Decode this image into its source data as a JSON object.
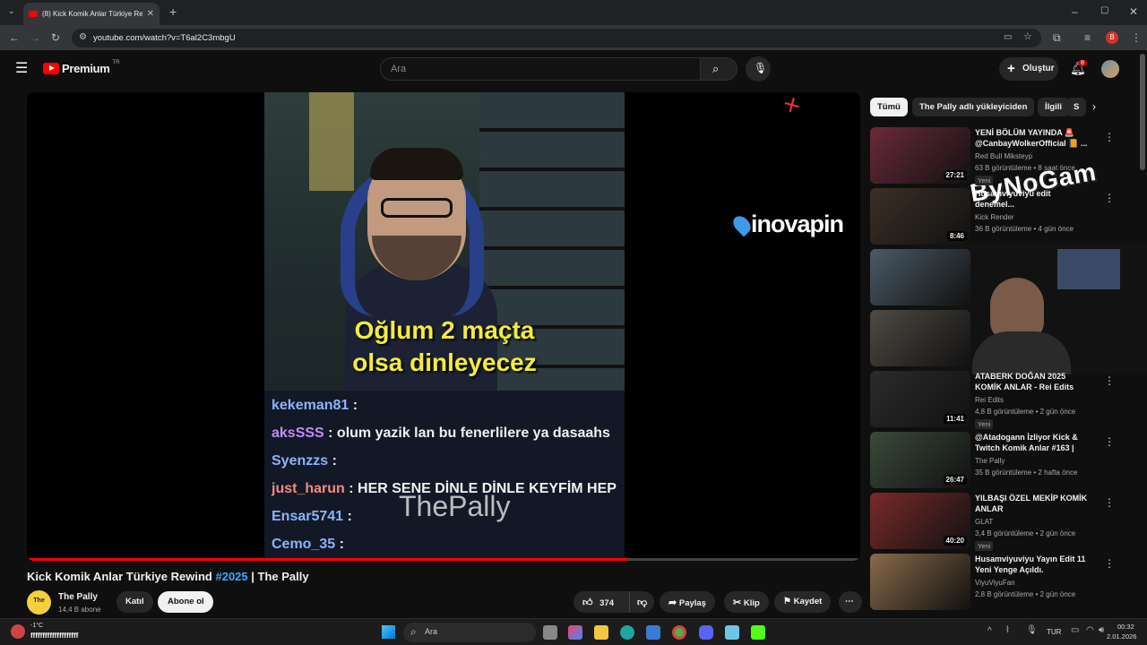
{
  "browser": {
    "tab_title": "(8) Kick Komik Anlar Türkiye Re...",
    "url": "youtube.com/watch?v=T6al2C3mbgU",
    "profile_letter": "B"
  },
  "youtube": {
    "logo_text": "Premium",
    "logo_badge": "TR",
    "search_placeholder": "Ara",
    "create_label": "Oluştur",
    "notif_count": "8"
  },
  "video": {
    "caption_line1": "Oğlum 2 maçta",
    "caption_line2": "olsa dinleyecez",
    "watermark": "ThePally",
    "overlay_brand": "inovapin",
    "overlay_logo": "ByNoGam",
    "chat": [
      {
        "user": "kekeman81",
        "msg": ":",
        "color": "#8ab4f8"
      },
      {
        "user": "aksSSS",
        "msg": ": olum yazik lan bu fenerlilere ya dasaahs",
        "color": "#c58af9"
      },
      {
        "user": "Syenzzs",
        "msg": ":",
        "color": "#8ab4f8"
      },
      {
        "user": "just_harun",
        "msg": ": HER SENE DİNLE DİNLE KEYFİM HEP",
        "color": "#f28b82"
      },
      {
        "user": "Ensar5741",
        "msg": ":",
        "color": "#8ab4f8"
      },
      {
        "user": "Cemo_35",
        "msg": ":",
        "color": "#8ab4f8"
      }
    ],
    "title_main": "Kick Komik Anlar Türkiye Rewind",
    "title_tag": "#2025",
    "title_tail": "| The Pally",
    "channel_name": "The Pally",
    "channel_subs": "14,4 B abone",
    "join_label": "Katıl",
    "subscribe_label": "Abone ol",
    "likes": "374",
    "share_label": "Paylaş",
    "clip_label": "Klip",
    "save_label": "Kaydet",
    "progress": 0.72
  },
  "sidebar": {
    "chips": [
      "Tümü",
      "The Pally adlı yükleyiciden",
      "İlgili",
      "S"
    ],
    "cards": [
      {
        "title": "YENİ BÖLÜM YAYINDA 🚨 @CanbayWolkerOfficial 📙 ...",
        "channel": "Red Bull Miksteyp",
        "meta": "63 B görüntüleme • 8 saat önce",
        "badge": "Yeni",
        "duration": "27:21",
        "thumb": "#6b2a3a"
      },
      {
        "title": "Husamviyuviyu edit denemel...",
        "channel": "Kick Render",
        "meta": "36 B görüntüleme • 4 gün önce",
        "badge": "",
        "duration": "8:46",
        "thumb": "#3b3026"
      },
      {
        "title": "",
        "channel": "",
        "meta": "",
        "badge": "",
        "duration": "",
        "thumb": "#4a5a66"
      },
      {
        "title": "",
        "channel": "",
        "meta": "",
        "badge": "",
        "duration": "",
        "thumb": "#4f4a44"
      },
      {
        "title": "ATABERK DOĞAN 2025 KOMİK ANLAR - Rei Edits",
        "channel": "Rei Edits",
        "meta": "4,8 B görüntüleme • 2 gün önce",
        "badge": "Yeni",
        "duration": "11:41",
        "thumb": "#2b2b2b"
      },
      {
        "title": "@Atadogann İzliyor Kick & Twitch Komik Anlar #163 | The...",
        "channel": "The Pally",
        "meta": "35 B görüntüleme • 2 hafta önce",
        "badge": "",
        "duration": "26:47",
        "thumb": "#3a4a3a"
      },
      {
        "title": "YILBAŞI ÖZEL MEKİP KOMİK ANLAR",
        "channel": "GLAT",
        "meta": "3,4 B görüntüleme • 2 gün önce",
        "badge": "Yeni",
        "duration": "40:20",
        "thumb": "#7a2a2a"
      },
      {
        "title": "Husamviyuviyu Yayın Edit 11 Yeni Yenge Açıldı.",
        "channel": "ViyuViyuFan",
        "meta": "2,8 B görüntüleme • 2 gün önce",
        "badge": "",
        "duration": "",
        "thumb": "#8a6a4a"
      }
    ]
  },
  "taskbar": {
    "weather_temp": "-1°C",
    "status_text": "ffffffffffffffffffff",
    "search_label": "Ara",
    "lang": "TUR",
    "time": "00:32",
    "date": "2.01.2026"
  }
}
